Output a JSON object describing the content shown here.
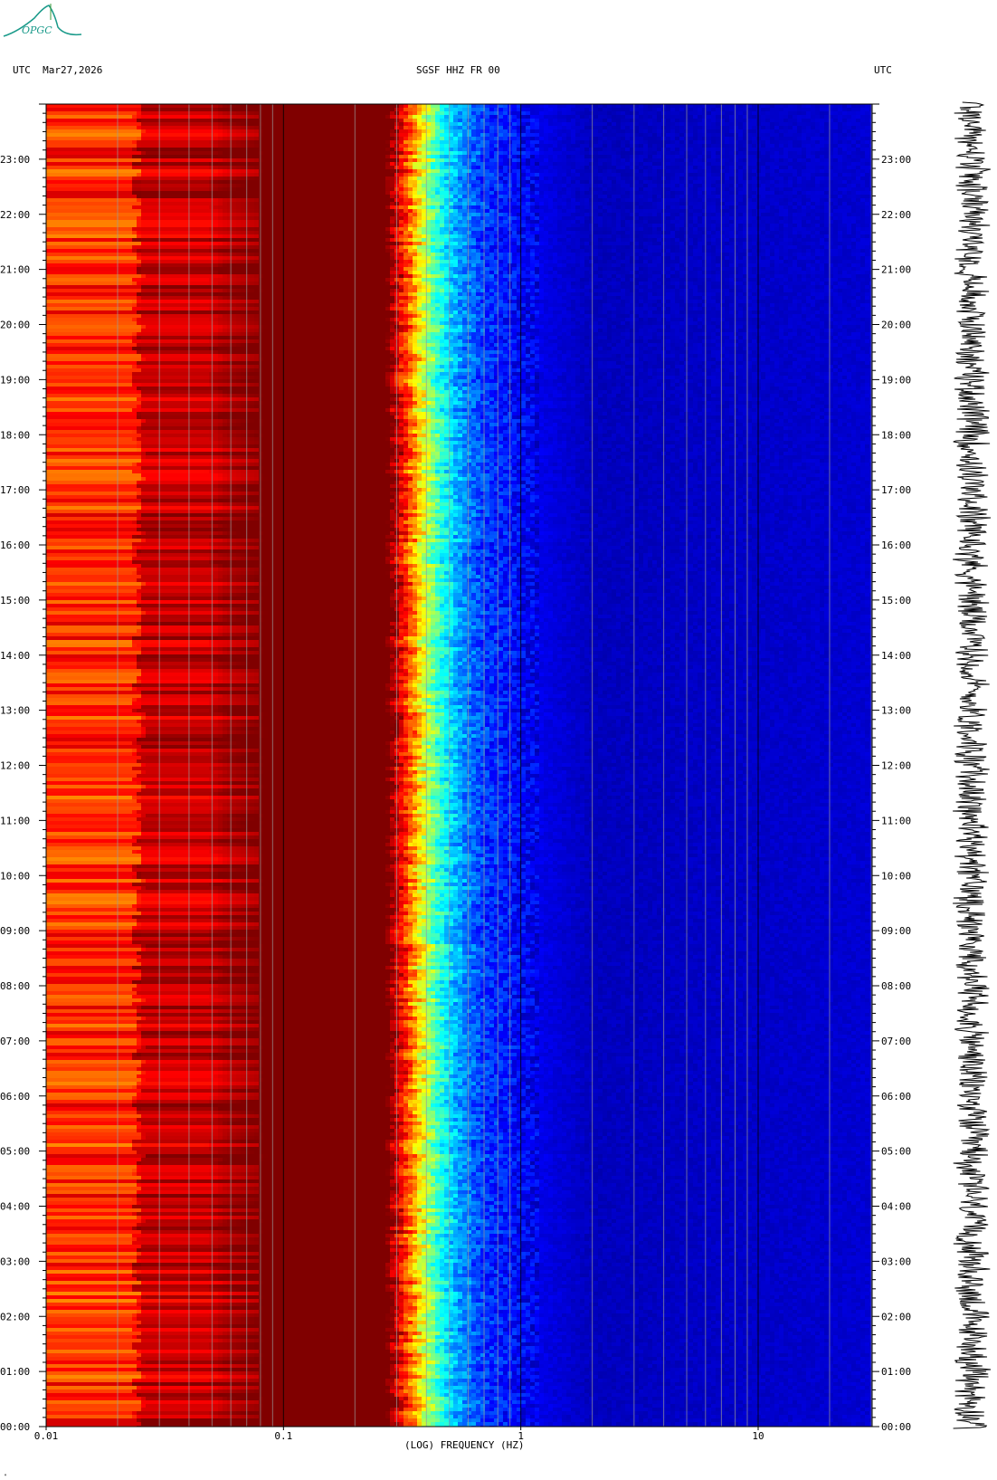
{
  "header": {
    "left": "UTC  Mar27,2026",
    "center": "SGSF HHZ FR 00",
    "right": "UTC"
  },
  "logo": {
    "text": "OPGC"
  },
  "colors": {
    "background": "#ffffff",
    "spectrogram_low": "#000096",
    "spectrogram_high": "#800000",
    "grid_line": "#888888"
  },
  "chart_data": {
    "type": "heatmap",
    "title": "SGSF HHZ FR 00",
    "xlabel": "(LOG) FREQUENCY (HZ)",
    "ylabel": "UTC",
    "x_scale": "log",
    "xlim": [
      0.01,
      30
    ],
    "x_ticks": [
      "0.01",
      "0.1",
      "1",
      "10"
    ],
    "y_ticks": [
      "00:00",
      "01:00",
      "02:00",
      "03:00",
      "04:00",
      "05:00",
      "06:00",
      "07:00",
      "08:00",
      "09:00",
      "10:00",
      "11:00",
      "12:00",
      "13:00",
      "14:00",
      "15:00",
      "16:00",
      "17:00",
      "18:00",
      "19:00",
      "20:00",
      "21:00",
      "22:00",
      "23:00"
    ],
    "colormap": "jet",
    "power_profile": [
      {
        "freq": 0.01,
        "level": 0.83
      },
      {
        "freq": 0.024,
        "level": 0.83
      },
      {
        "freq": 0.0245,
        "level": 0.93
      },
      {
        "freq": 0.05,
        "level": 0.93
      },
      {
        "freq": 0.055,
        "level": 0.96
      },
      {
        "freq": 0.08,
        "level": 1.0
      },
      {
        "freq": 0.28,
        "level": 1.0
      },
      {
        "freq": 0.33,
        "level": 0.82
      },
      {
        "freq": 0.38,
        "level": 0.62
      },
      {
        "freq": 0.45,
        "level": 0.42
      },
      {
        "freq": 0.55,
        "level": 0.28
      },
      {
        "freq": 0.7,
        "level": 0.18
      },
      {
        "freq": 1.0,
        "level": 0.12
      },
      {
        "freq": 2.0,
        "level": 0.06
      },
      {
        "freq": 30,
        "level": 0.08
      }
    ],
    "waveform_trace": "seismogram"
  },
  "xaxis_label": "(LOG) FREQUENCY (HZ)",
  "corner_mark": "\""
}
